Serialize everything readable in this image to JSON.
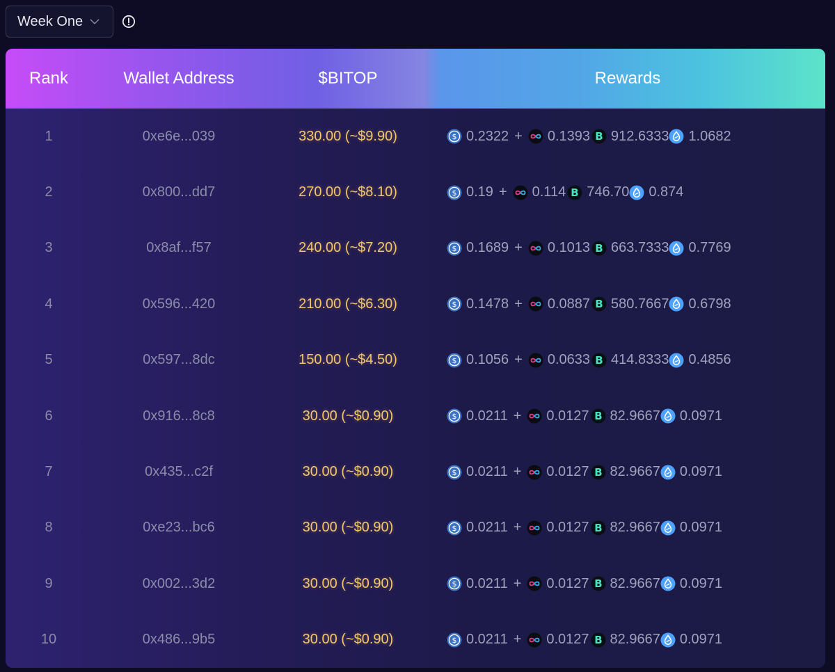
{
  "selector": {
    "label": "Week One"
  },
  "header": {
    "rank": "Rank",
    "wallet": "Wallet Address",
    "bitop": "$BITOP",
    "rewards": "Rewards"
  },
  "colors": {
    "bitop_text": "#f5c76a",
    "muted_text": "#8a8ca8",
    "usdc_icon": "#3e73c4",
    "sui_icon": "#4da2ff"
  },
  "icons": [
    "usdc-icon",
    "icp-infinity-icon",
    "bitop-b-icon",
    "sui-drop-icon"
  ],
  "rows": [
    {
      "rank": "1",
      "wallet": "0xe6e...039",
      "bitop": "330.00 (~$9.90)",
      "r1": "0.2322",
      "r2": "0.1393",
      "r3": "912.6333",
      "r4": "1.0682"
    },
    {
      "rank": "2",
      "wallet": "0x800...dd7",
      "bitop": "270.00 (~$8.10)",
      "r1": "0.19",
      "r2": "0.114",
      "r3": "746.70",
      "r4": "0.874"
    },
    {
      "rank": "3",
      "wallet": "0x8af...f57",
      "bitop": "240.00 (~$7.20)",
      "r1": "0.1689",
      "r2": "0.1013",
      "r3": "663.7333",
      "r4": "0.7769"
    },
    {
      "rank": "4",
      "wallet": "0x596...420",
      "bitop": "210.00 (~$6.30)",
      "r1": "0.1478",
      "r2": "0.0887",
      "r3": "580.7667",
      "r4": "0.6798"
    },
    {
      "rank": "5",
      "wallet": "0x597...8dc",
      "bitop": "150.00 (~$4.50)",
      "r1": "0.1056",
      "r2": "0.0633",
      "r3": "414.8333",
      "r4": "0.4856"
    },
    {
      "rank": "6",
      "wallet": "0x916...8c8",
      "bitop": "30.00 (~$0.90)",
      "r1": "0.0211",
      "r2": "0.0127",
      "r3": "82.9667",
      "r4": "0.0971"
    },
    {
      "rank": "7",
      "wallet": "0x435...c2f",
      "bitop": "30.00 (~$0.90)",
      "r1": "0.0211",
      "r2": "0.0127",
      "r3": "82.9667",
      "r4": "0.0971"
    },
    {
      "rank": "8",
      "wallet": "0xe23...bc6",
      "bitop": "30.00 (~$0.90)",
      "r1": "0.0211",
      "r2": "0.0127",
      "r3": "82.9667",
      "r4": "0.0971"
    },
    {
      "rank": "9",
      "wallet": "0x002...3d2",
      "bitop": "30.00 (~$0.90)",
      "r1": "0.0211",
      "r2": "0.0127",
      "r3": "82.9667",
      "r4": "0.0971"
    },
    {
      "rank": "10",
      "wallet": "0x486...9b5",
      "bitop": "30.00 (~$0.90)",
      "r1": "0.0211",
      "r2": "0.0127",
      "r3": "82.9667",
      "r4": "0.0971"
    }
  ]
}
